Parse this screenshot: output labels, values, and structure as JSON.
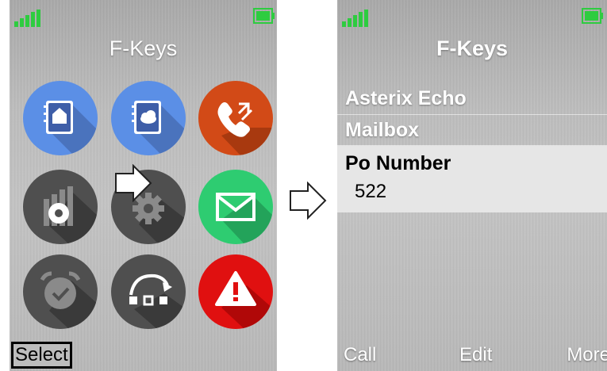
{
  "left_screen": {
    "title": "F-Keys",
    "softkey_left": "Select",
    "icons": [
      "contacts-book-home-icon",
      "contacts-book-cloud-icon",
      "call-transfer-icon",
      "settings-bars-icon",
      "settings-gear-icon",
      "messaging-envelope-icon",
      "alarm-clock-icon",
      "profile-rotate-icon",
      "alert-warning-icon"
    ],
    "colors": {
      "blue": "#5b8fe6",
      "orange": "#d24a17",
      "dark_gray": "#4f4f4f",
      "green": "#2ecc71",
      "red": "#e01010"
    }
  },
  "right_screen": {
    "title": "F-Keys",
    "items": [
      {
        "label": "Asterix Echo"
      },
      {
        "label": "Mailbox"
      },
      {
        "label": "Po Number",
        "value": "522"
      }
    ],
    "softkey_left": "Call",
    "softkey_center": "Edit",
    "softkey_right": "More"
  }
}
